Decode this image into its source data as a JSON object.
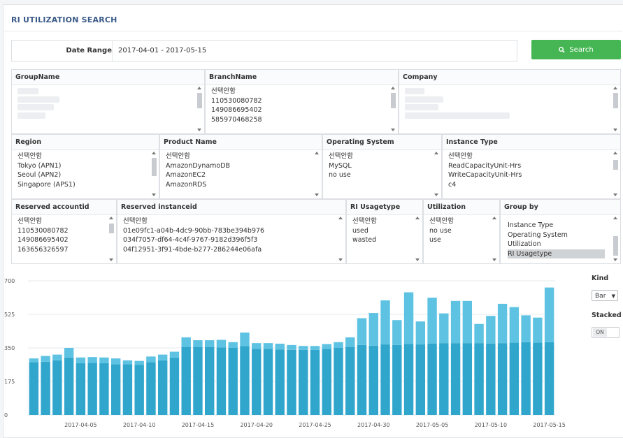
{
  "title": "RI UTILIZATION SEARCH",
  "date_range": {
    "label": "Date Range",
    "value": "2017-04-01 - 2017-05-15"
  },
  "search_button": {
    "label": "Search",
    "icon": "search-icon",
    "color": "#45b653"
  },
  "filters": {
    "group_name": {
      "label": "GroupName",
      "options": []
    },
    "branch_name": {
      "label": "BranchName",
      "options": [
        "선택안함",
        "110530080782",
        "149086695402",
        "585970468258"
      ]
    },
    "company": {
      "label": "Company",
      "options": []
    },
    "region": {
      "label": "Region",
      "options": [
        "선택안함",
        "Tokyo (APN1)",
        "Seoul (APN2)",
        "Singapore (APS1)"
      ]
    },
    "product_name": {
      "label": "Product Name",
      "options": [
        "선택안함",
        "AmazonDynamoDB",
        "AmazonEC2",
        "AmazonRDS"
      ]
    },
    "operating_system": {
      "label": "Operating System",
      "options": [
        "선택안함",
        "MySQL",
        "no use"
      ]
    },
    "instance_type": {
      "label": "Instance Type",
      "options": [
        "선택안함",
        "ReadCapacityUnit-Hrs",
        "WriteCapacityUnit-Hrs",
        "c4"
      ]
    },
    "reserved_accountid": {
      "label": "Reserved accountid",
      "options": [
        "선택안함",
        "110530080782",
        "149086695402",
        "163656326597"
      ]
    },
    "reserved_instanceid": {
      "label": "Reserved instanceid",
      "options": [
        "선택안함",
        "01e09fc1-a04b-4dc9-90bb-783be394b976",
        "034f7057-df64-4c4f-9767-9182d396f5f3",
        "04f12951-3f91-4bde-b277-286244e06afa"
      ]
    },
    "ri_usagetype": {
      "label": "RI Usagetype",
      "options": [
        "선택안함",
        "used",
        "wasted"
      ]
    },
    "utilization": {
      "label": "Utilization",
      "options": [
        "선택안함",
        "no use",
        "use"
      ]
    },
    "group_by": {
      "label": "Group by",
      "options": [
        "Instance Type",
        "Operating System",
        "Utilization",
        "RI Usagetype"
      ],
      "selected": "RI Usagetype"
    }
  },
  "controls": {
    "kind_label": "Kind",
    "kind_value": "Bar",
    "stacked_label": "Stacked",
    "stacked_value": "ON"
  },
  "chart_data": {
    "type": "bar",
    "stacked": true,
    "ylim": [
      0,
      700
    ],
    "yticks": [
      0,
      175,
      350,
      525,
      700
    ],
    "x_tick_labels": [
      "2017-04-05",
      "2017-04-10",
      "2017-04-15",
      "2017-04-20",
      "2017-04-25",
      "2017-04-30",
      "2017-05-05",
      "2017-05-10",
      "2017-05-15"
    ],
    "categories": [
      "2017-04-01",
      "2017-04-02",
      "2017-04-03",
      "2017-04-04",
      "2017-04-05",
      "2017-04-06",
      "2017-04-07",
      "2017-04-08",
      "2017-04-09",
      "2017-04-10",
      "2017-04-11",
      "2017-04-12",
      "2017-04-13",
      "2017-04-14",
      "2017-04-15",
      "2017-04-16",
      "2017-04-17",
      "2017-04-18",
      "2017-04-19",
      "2017-04-20",
      "2017-04-21",
      "2017-04-22",
      "2017-04-23",
      "2017-04-24",
      "2017-04-25",
      "2017-04-26",
      "2017-04-27",
      "2017-04-28",
      "2017-04-29",
      "2017-04-30",
      "2017-05-01",
      "2017-05-02",
      "2017-05-03",
      "2017-05-04",
      "2017-05-05",
      "2017-05-06",
      "2017-05-07",
      "2017-05-08",
      "2017-05-09",
      "2017-05-10",
      "2017-05-11",
      "2017-05-12",
      "2017-05-13",
      "2017-05-14",
      "2017-05-15"
    ],
    "series": [
      {
        "color": "#30a6cc",
        "values": [
          275,
          278,
          285,
          300,
          270,
          272,
          270,
          265,
          265,
          262,
          275,
          285,
          300,
          355,
          355,
          355,
          352,
          350,
          360,
          345,
          345,
          342,
          340,
          340,
          340,
          345,
          350,
          355,
          365,
          362,
          368,
          365,
          370,
          368,
          372,
          375,
          375,
          375,
          375,
          372,
          375,
          378,
          380,
          378,
          380
        ]
      },
      {
        "color": "#5ec3e2",
        "values": [
          20,
          30,
          30,
          50,
          30,
          30,
          30,
          30,
          20,
          20,
          30,
          30,
          30,
          50,
          35,
          35,
          40,
          30,
          70,
          30,
          30,
          30,
          25,
          20,
          20,
          25,
          30,
          50,
          140,
          170,
          230,
          130,
          270,
          120,
          240,
          155,
          220,
          220,
          100,
          145,
          205,
          185,
          140,
          130,
          285
        ]
      }
    ]
  }
}
